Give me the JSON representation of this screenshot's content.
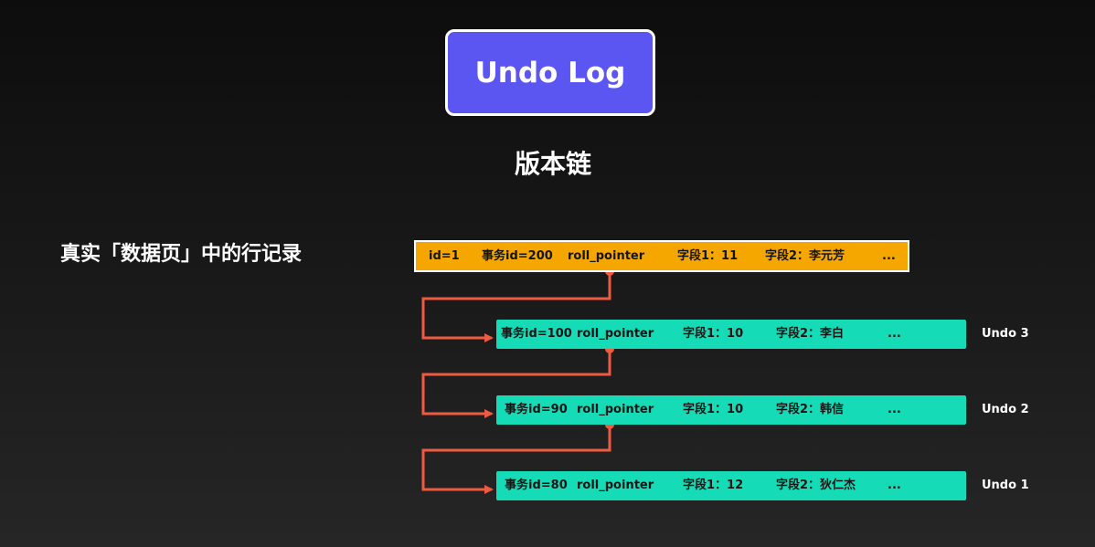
{
  "header": {
    "title": "Undo Log",
    "subtitle": "版本链"
  },
  "left_label": "真实「数据页」中的行记录",
  "current_record": {
    "id": "id=1",
    "trx_id": "事务id=200",
    "roll_pointer": "roll_pointer",
    "field1": "字段1：11",
    "field2": "字段2：李元芳",
    "more": "..."
  },
  "undo_records": [
    {
      "trx_id": "事务id=100",
      "roll_pointer": "roll_pointer",
      "field1": "字段1：10",
      "field2": "字段2：李白",
      "more": "...",
      "label": "Undo 3"
    },
    {
      "trx_id": "事务id=90",
      "roll_pointer": "roll_pointer",
      "field1": "字段1：10",
      "field2": "字段2：韩信",
      "more": "...",
      "label": "Undo 2"
    },
    {
      "trx_id": "事务id=80",
      "roll_pointer": "roll_pointer",
      "field1": "字段1：12",
      "field2": "字段2：狄仁杰",
      "more": "...",
      "label": "Undo 1"
    }
  ],
  "colors": {
    "title_box": "#5b55f2",
    "current_row": "#f5a700",
    "undo_row": "#16dbb7",
    "arrow": "#ef5a40"
  }
}
